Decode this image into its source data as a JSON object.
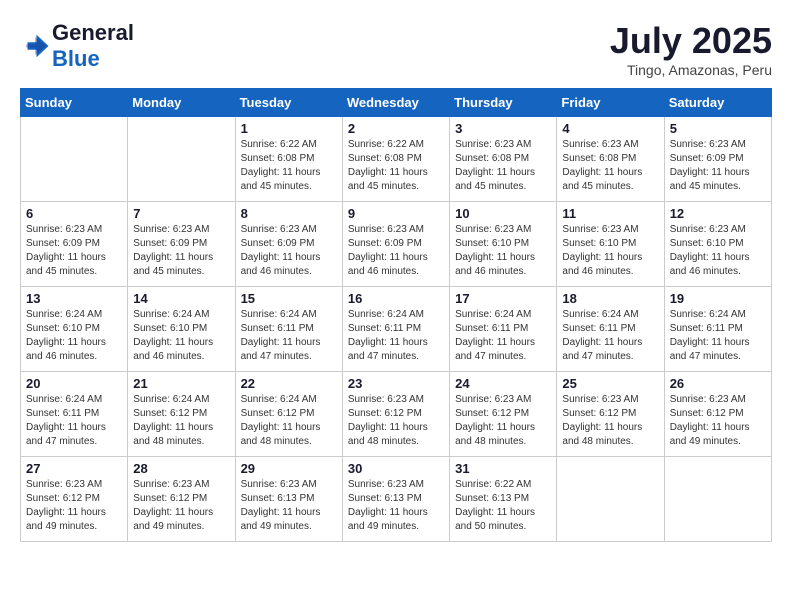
{
  "header": {
    "logo_general": "General",
    "logo_blue": "Blue",
    "month_title": "July 2025",
    "location": "Tingo, Amazonas, Peru"
  },
  "weekdays": [
    "Sunday",
    "Monday",
    "Tuesday",
    "Wednesday",
    "Thursday",
    "Friday",
    "Saturday"
  ],
  "weeks": [
    [
      {
        "day": "",
        "info": ""
      },
      {
        "day": "",
        "info": ""
      },
      {
        "day": "1",
        "info": "Sunrise: 6:22 AM\nSunset: 6:08 PM\nDaylight: 11 hours and 45 minutes."
      },
      {
        "day": "2",
        "info": "Sunrise: 6:22 AM\nSunset: 6:08 PM\nDaylight: 11 hours and 45 minutes."
      },
      {
        "day": "3",
        "info": "Sunrise: 6:23 AM\nSunset: 6:08 PM\nDaylight: 11 hours and 45 minutes."
      },
      {
        "day": "4",
        "info": "Sunrise: 6:23 AM\nSunset: 6:08 PM\nDaylight: 11 hours and 45 minutes."
      },
      {
        "day": "5",
        "info": "Sunrise: 6:23 AM\nSunset: 6:09 PM\nDaylight: 11 hours and 45 minutes."
      }
    ],
    [
      {
        "day": "6",
        "info": "Sunrise: 6:23 AM\nSunset: 6:09 PM\nDaylight: 11 hours and 45 minutes."
      },
      {
        "day": "7",
        "info": "Sunrise: 6:23 AM\nSunset: 6:09 PM\nDaylight: 11 hours and 45 minutes."
      },
      {
        "day": "8",
        "info": "Sunrise: 6:23 AM\nSunset: 6:09 PM\nDaylight: 11 hours and 46 minutes."
      },
      {
        "day": "9",
        "info": "Sunrise: 6:23 AM\nSunset: 6:09 PM\nDaylight: 11 hours and 46 minutes."
      },
      {
        "day": "10",
        "info": "Sunrise: 6:23 AM\nSunset: 6:10 PM\nDaylight: 11 hours and 46 minutes."
      },
      {
        "day": "11",
        "info": "Sunrise: 6:23 AM\nSunset: 6:10 PM\nDaylight: 11 hours and 46 minutes."
      },
      {
        "day": "12",
        "info": "Sunrise: 6:23 AM\nSunset: 6:10 PM\nDaylight: 11 hours and 46 minutes."
      }
    ],
    [
      {
        "day": "13",
        "info": "Sunrise: 6:24 AM\nSunset: 6:10 PM\nDaylight: 11 hours and 46 minutes."
      },
      {
        "day": "14",
        "info": "Sunrise: 6:24 AM\nSunset: 6:10 PM\nDaylight: 11 hours and 46 minutes."
      },
      {
        "day": "15",
        "info": "Sunrise: 6:24 AM\nSunset: 6:11 PM\nDaylight: 11 hours and 47 minutes."
      },
      {
        "day": "16",
        "info": "Sunrise: 6:24 AM\nSunset: 6:11 PM\nDaylight: 11 hours and 47 minutes."
      },
      {
        "day": "17",
        "info": "Sunrise: 6:24 AM\nSunset: 6:11 PM\nDaylight: 11 hours and 47 minutes."
      },
      {
        "day": "18",
        "info": "Sunrise: 6:24 AM\nSunset: 6:11 PM\nDaylight: 11 hours and 47 minutes."
      },
      {
        "day": "19",
        "info": "Sunrise: 6:24 AM\nSunset: 6:11 PM\nDaylight: 11 hours and 47 minutes."
      }
    ],
    [
      {
        "day": "20",
        "info": "Sunrise: 6:24 AM\nSunset: 6:11 PM\nDaylight: 11 hours and 47 minutes."
      },
      {
        "day": "21",
        "info": "Sunrise: 6:24 AM\nSunset: 6:12 PM\nDaylight: 11 hours and 48 minutes."
      },
      {
        "day": "22",
        "info": "Sunrise: 6:24 AM\nSunset: 6:12 PM\nDaylight: 11 hours and 48 minutes."
      },
      {
        "day": "23",
        "info": "Sunrise: 6:23 AM\nSunset: 6:12 PM\nDaylight: 11 hours and 48 minutes."
      },
      {
        "day": "24",
        "info": "Sunrise: 6:23 AM\nSunset: 6:12 PM\nDaylight: 11 hours and 48 minutes."
      },
      {
        "day": "25",
        "info": "Sunrise: 6:23 AM\nSunset: 6:12 PM\nDaylight: 11 hours and 48 minutes."
      },
      {
        "day": "26",
        "info": "Sunrise: 6:23 AM\nSunset: 6:12 PM\nDaylight: 11 hours and 49 minutes."
      }
    ],
    [
      {
        "day": "27",
        "info": "Sunrise: 6:23 AM\nSunset: 6:12 PM\nDaylight: 11 hours and 49 minutes."
      },
      {
        "day": "28",
        "info": "Sunrise: 6:23 AM\nSunset: 6:12 PM\nDaylight: 11 hours and 49 minutes."
      },
      {
        "day": "29",
        "info": "Sunrise: 6:23 AM\nSunset: 6:13 PM\nDaylight: 11 hours and 49 minutes."
      },
      {
        "day": "30",
        "info": "Sunrise: 6:23 AM\nSunset: 6:13 PM\nDaylight: 11 hours and 49 minutes."
      },
      {
        "day": "31",
        "info": "Sunrise: 6:22 AM\nSunset: 6:13 PM\nDaylight: 11 hours and 50 minutes."
      },
      {
        "day": "",
        "info": ""
      },
      {
        "day": "",
        "info": ""
      }
    ]
  ]
}
